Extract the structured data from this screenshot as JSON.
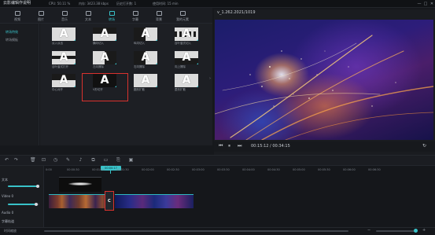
{
  "window": {
    "title": "云影编辑作说明",
    "stats": [
      "CPU: 50.11 %",
      "内存: 3423.38 kbps",
      "历史打开数: 1",
      "使用时间: 15 min"
    ],
    "controls": [
      "—",
      "□",
      "✕"
    ]
  },
  "media_tabs": [
    {
      "label": "视频",
      "icon": "video-icon",
      "active": false
    },
    {
      "label": "图片",
      "icon": "image-icon",
      "active": false
    },
    {
      "label": "音乐",
      "icon": "music-icon",
      "active": false
    },
    {
      "label": "文本",
      "icon": "text-icon",
      "active": false
    },
    {
      "label": "转场",
      "icon": "transition-icon",
      "active": true
    },
    {
      "label": "字幕",
      "icon": "caption-icon",
      "active": false
    },
    {
      "label": "背景",
      "icon": "background-icon",
      "active": false
    },
    {
      "label": "我的元素",
      "icon": "element-icon",
      "active": false
    }
  ],
  "side_nav": [
    {
      "label": "转场特效",
      "active": true
    },
    {
      "label": "转场模板",
      "active": false
    }
  ],
  "transitions": [
    {
      "label": "淡入淡出",
      "variant": "plain"
    },
    {
      "label": "横向切入",
      "variant": "dark-top"
    },
    {
      "label": "纵向切入",
      "variant": "dark-left"
    },
    {
      "label": "百叶窗式切入",
      "variant": "stripes"
    },
    {
      "label": "百叶窗式打开",
      "variant": "hstripe"
    },
    {
      "label": "左向擦除",
      "variant": "dark-right"
    },
    {
      "label": "右向擦除",
      "variant": "dark-left"
    },
    {
      "label": "向上擦除",
      "variant": "dark-bottom"
    },
    {
      "label": "中心对开",
      "variant": "dark-top"
    },
    {
      "label": "V形切开",
      "variant": "dark-full"
    },
    {
      "label": "圆形扩散",
      "variant": "plain"
    },
    {
      "label": "菱形扩散",
      "variant": "plain"
    }
  ],
  "preview": {
    "title": "v_1.262.2021/1019",
    "time": "00:15:12 / 00:34:15",
    "controls": [
      "⏮",
      "⏸",
      "⏭",
      "↻"
    ]
  },
  "timeline": {
    "ruler_labels": [
      "0:00",
      "00:00:30",
      "00:01:00",
      "00:01:30",
      "00:02:00",
      "00:02:30",
      "00:03:00",
      "00:03:30",
      "00:04:00",
      "00:04:30",
      "00:05:00",
      "00:05:30",
      "00:06:00",
      "00:06:30"
    ],
    "playhead_label": "00:00:17",
    "tracks": [
      {
        "label": "文本",
        "volume": 0.95
      },
      {
        "label": "Video 0",
        "volume": 0.9
      },
      {
        "label": "Audio 0",
        "volume": null
      },
      {
        "label": "字幕轨道",
        "volume": null
      }
    ],
    "transition_marker": "C"
  },
  "bottom": {
    "label": "时间缩放"
  }
}
